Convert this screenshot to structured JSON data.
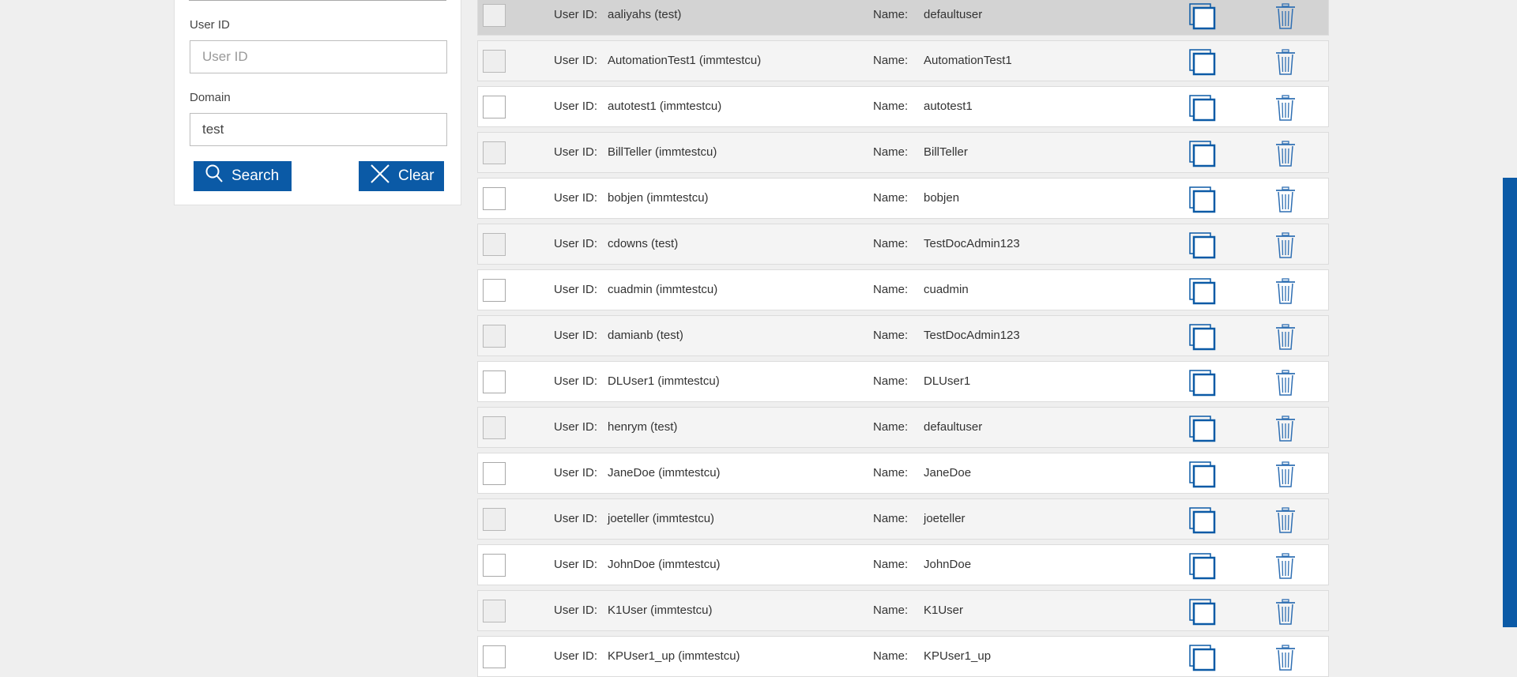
{
  "filter": {
    "user_id_label": "User ID",
    "user_id_placeholder": "User ID",
    "user_id_value": "",
    "domain_label": "Domain",
    "domain_value": "test",
    "search_label": "Search",
    "clear_label": "Clear"
  },
  "labels": {
    "user_id": "User ID:",
    "name": "Name:"
  },
  "colors": {
    "accent": "#0b5aa6",
    "row_selected": "#d3d3d3",
    "row_alt": "#f4f4f4"
  },
  "rows": [
    {
      "user_id": "aaliyahs (test)",
      "name": "defaultuser",
      "selected": true
    },
    {
      "user_id": "AutomationTest1 (immtestcu)",
      "name": "AutomationTest1"
    },
    {
      "user_id": "autotest1 (immtestcu)",
      "name": "autotest1"
    },
    {
      "user_id": "BillTeller (immtestcu)",
      "name": "BillTeller"
    },
    {
      "user_id": "bobjen (immtestcu)",
      "name": "bobjen"
    },
    {
      "user_id": "cdowns (test)",
      "name": "TestDocAdmin123"
    },
    {
      "user_id": "cuadmin (immtestcu)",
      "name": "cuadmin"
    },
    {
      "user_id": "damianb (test)",
      "name": "TestDocAdmin123"
    },
    {
      "user_id": "DLUser1 (immtestcu)",
      "name": "DLUser1"
    },
    {
      "user_id": "henrym (test)",
      "name": "defaultuser"
    },
    {
      "user_id": "JaneDoe (immtestcu)",
      "name": "JaneDoe"
    },
    {
      "user_id": "joeteller (immtestcu)",
      "name": "joeteller"
    },
    {
      "user_id": "JohnDoe (immtestcu)",
      "name": "JohnDoe"
    },
    {
      "user_id": "K1User (immtestcu)",
      "name": "K1User"
    },
    {
      "user_id": "KPUser1_up (immtestcu)",
      "name": "KPUser1_up"
    }
  ]
}
